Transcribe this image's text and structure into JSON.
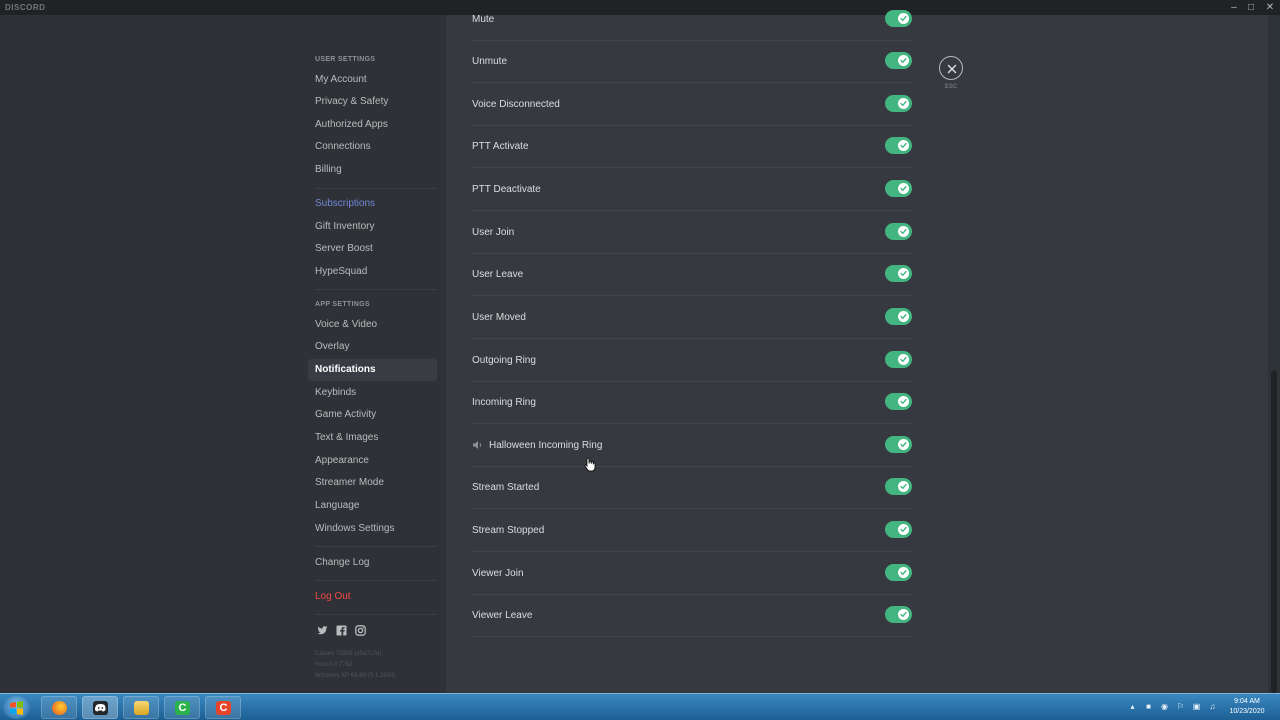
{
  "window": {
    "brand": "DISCORD",
    "controls": [
      "–",
      "□",
      "✕"
    ]
  },
  "sidebar": {
    "user_settings_header": "USER SETTINGS",
    "user_items": [
      "My Account",
      "Privacy & Safety",
      "Authorized Apps",
      "Connections",
      "Billing"
    ],
    "billing_items": [
      "Subscriptions",
      "Gift Inventory",
      "Server Boost",
      "HypeSquad"
    ],
    "app_settings_header": "APP SETTINGS",
    "app_items": [
      "Voice & Video",
      "Overlay",
      "Notifications",
      "Keybinds",
      "Game Activity",
      "Text & Images",
      "Appearance",
      "Streamer Mode",
      "Language",
      "Windows Settings"
    ],
    "active_item": "Notifications",
    "change_log": "Change Log",
    "log_out": "Log Out",
    "version_lines": [
      "Canary 70305 (e5d7c7d)",
      "Host 0.0.7762",
      "Windows XP 64-Bit (5.1.2600)"
    ]
  },
  "sounds": [
    {
      "label": "Mute",
      "enabled": true
    },
    {
      "label": "Unmute",
      "enabled": true
    },
    {
      "label": "Voice Disconnected",
      "enabled": true
    },
    {
      "label": "PTT Activate",
      "enabled": true
    },
    {
      "label": "PTT Deactivate",
      "enabled": true
    },
    {
      "label": "User Join",
      "enabled": true
    },
    {
      "label": "User Leave",
      "enabled": true
    },
    {
      "label": "User Moved",
      "enabled": true
    },
    {
      "label": "Outgoing Ring",
      "enabled": true
    },
    {
      "label": "Incoming Ring",
      "enabled": true
    },
    {
      "label": "Halloween Incoming Ring",
      "enabled": true,
      "speaker_icon": true
    },
    {
      "label": "Stream Started",
      "enabled": true
    },
    {
      "label": "Stream Stopped",
      "enabled": true
    },
    {
      "label": "Viewer Join",
      "enabled": true
    },
    {
      "label": "Viewer Leave",
      "enabled": true
    }
  ],
  "close": {
    "label": "ESC"
  },
  "taskbar": {
    "clock_time": "9:04 AM",
    "clock_date": "10/23/2020",
    "apps": [
      "firefox-icon",
      "discord-icon",
      "folder-icon",
      "camtasia-green-icon",
      "camtasia-red-icon"
    ]
  },
  "colors": {
    "toggle_on": "#43b581",
    "accent": "#7289da",
    "danger": "#f04747",
    "content_bg": "#36393f",
    "sidebar_bg": "#2f3136"
  }
}
